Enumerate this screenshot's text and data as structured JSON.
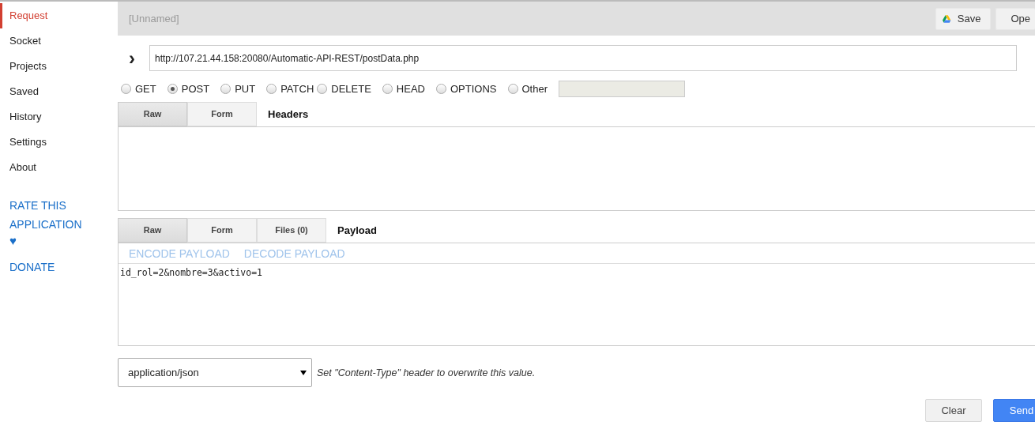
{
  "sidebar": {
    "items": [
      {
        "label": "Request",
        "selected": true
      },
      {
        "label": "Socket",
        "selected": false
      },
      {
        "label": "Projects",
        "selected": false
      },
      {
        "label": "Saved",
        "selected": false
      },
      {
        "label": "History",
        "selected": false
      },
      {
        "label": "Settings",
        "selected": false
      },
      {
        "label": "About",
        "selected": false
      }
    ],
    "links": [
      {
        "label": "RATE THIS APPLICATION",
        "kind": "text"
      },
      {
        "label": "♥",
        "kind": "heart"
      },
      {
        "label": "DONATE",
        "kind": "text"
      }
    ]
  },
  "top_bar": {
    "title": "[Unnamed]",
    "buttons": [
      {
        "label": "Save",
        "kind": "drive"
      },
      {
        "label": "Ope",
        "kind": "plain"
      }
    ]
  },
  "url": {
    "toggle": "›",
    "value": "http://107.21.44.158:20080/Automatic-API-REST/postData.php"
  },
  "methods": [
    {
      "label": "GET",
      "selected": false
    },
    {
      "label": "POST",
      "selected": true
    },
    {
      "label": "PUT",
      "selected": false
    },
    {
      "label": "PATCH",
      "selected": false
    },
    {
      "label": "DELETE",
      "selected": false
    },
    {
      "label": "HEAD",
      "selected": false
    },
    {
      "label": "OPTIONS",
      "selected": false
    },
    {
      "label": "Other",
      "selected": false
    }
  ],
  "headers": {
    "tabs": [
      {
        "label": "Raw",
        "selected": true
      },
      {
        "label": "Form",
        "selected": false
      }
    ],
    "title": "Headers"
  },
  "payload": {
    "tabs": [
      {
        "label": "Raw",
        "selected": true
      },
      {
        "label": "Form",
        "selected": false
      },
      {
        "label": "Files (0)",
        "selected": false
      }
    ],
    "title": "Payload",
    "actions": [
      "ENCODE PAYLOAD",
      "DECODE PAYLOAD"
    ],
    "value": "id_rol=2&nombre=3&activo=1"
  },
  "content_type": {
    "value": "application/json",
    "hint": "Set \"Content-Type\" header to overwrite this value."
  },
  "actions": [
    {
      "label": "Clear",
      "kind": "plain"
    },
    {
      "label": "Send",
      "kind": "primary"
    }
  ]
}
